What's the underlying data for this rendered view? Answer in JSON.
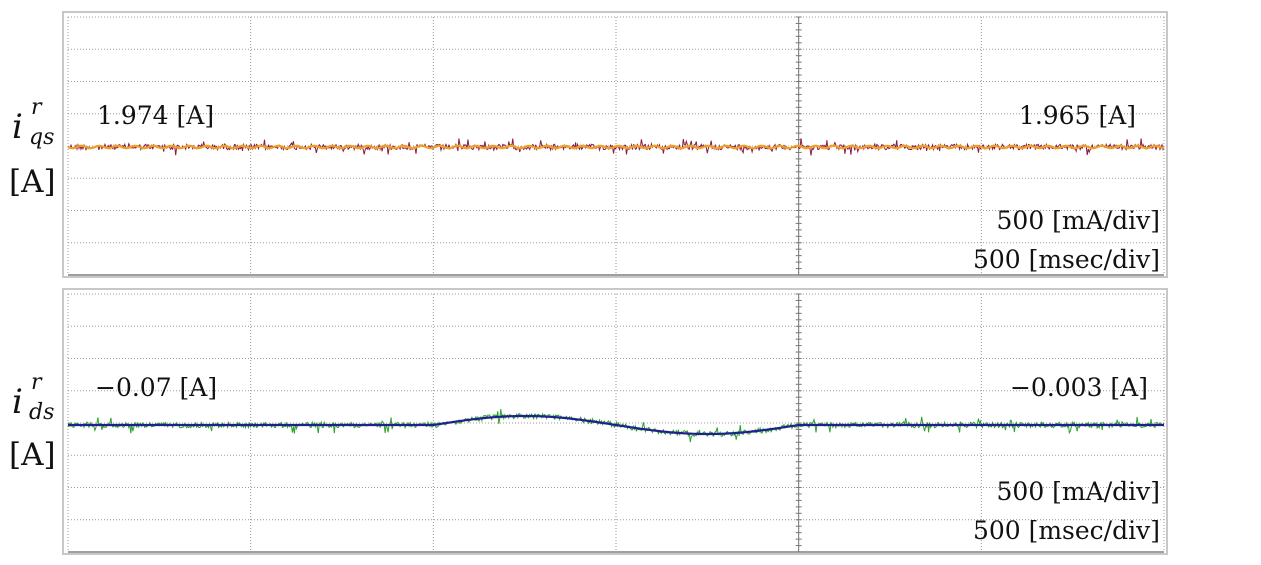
{
  "chart_data": [
    {
      "type": "line",
      "ylabel_main": "i",
      "ylabel_sub": "qs",
      "ylabel_sup": "r",
      "ylabel_unit": "[A]",
      "divisions": {
        "x": 6,
        "y": 8
      },
      "y_per_div": 0.5,
      "y_center_div": 4,
      "annotations": {
        "left_value": "1.974 [A]",
        "right_value": "1.965 [A]",
        "scale_y": "500 [mA/div]",
        "scale_x": "500 [msec/div]"
      },
      "series": [
        {
          "role": "measured",
          "color": "#8b1a4a",
          "level": 1.974,
          "noise": 0.12
        },
        {
          "role": "filtered",
          "color": "#f0a020",
          "level": 1.97,
          "noise": 0.02
        }
      ]
    },
    {
      "type": "line",
      "ylabel_main": "i",
      "ylabel_sub": "ds",
      "ylabel_sup": "r",
      "ylabel_unit": "[A]",
      "divisions": {
        "x": 6,
        "y": 8
      },
      "y_per_div": 0.5,
      "y_center_div": 4,
      "annotations": {
        "left_value": "−0.07 [A]",
        "right_value": "−0.003 [A]",
        "scale_y": "500 [mA/div]",
        "scale_x": "500 [msec/div]"
      },
      "series": [
        {
          "role": "measured",
          "color": "#2ca02c",
          "noise": 0.12
        },
        {
          "role": "filtered",
          "color": "#1f1f8f",
          "noise": 0.0
        }
      ],
      "step_times_div": [
        2.0,
        4.0
      ],
      "sine_amplitude": 0.14
    }
  ]
}
